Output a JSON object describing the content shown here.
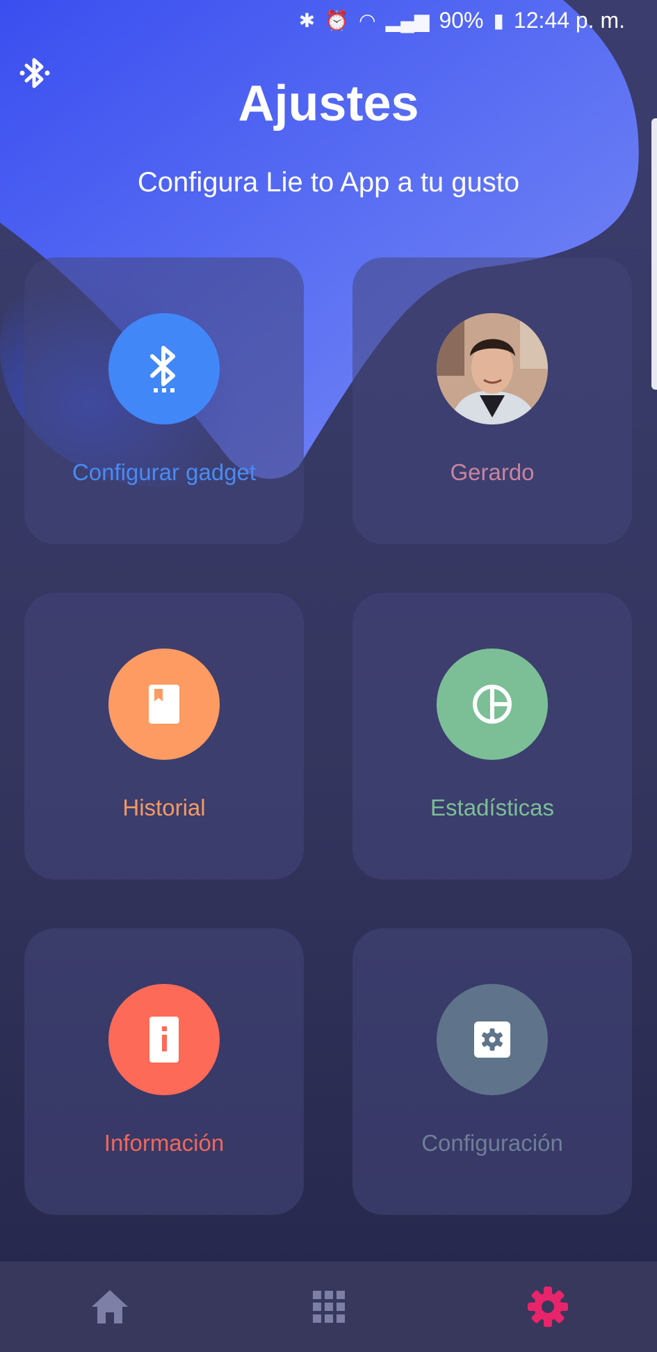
{
  "status_bar": {
    "battery": "90%",
    "time": "12:44 p. m.",
    "icons": [
      "bluetooth-icon",
      "alarm-icon",
      "wifi-icon",
      "signal-icon",
      "battery-icon"
    ]
  },
  "header": {
    "title": "Ajustes",
    "subtitle": "Configura Lie to App a tu gusto"
  },
  "cards": [
    {
      "label": "Configurar gadget",
      "icon": "bluetooth-searching-icon",
      "circle_color": "#4187f8",
      "label_color": "#4a8bf2"
    },
    {
      "label": "Gerardo",
      "icon": "avatar",
      "circle_color": "#b89882",
      "label_color": "#c9849f"
    },
    {
      "label": "Historial",
      "icon": "book-icon",
      "circle_color": "#fd9b62",
      "label_color": "#f59a62"
    },
    {
      "label": "Estadísticas",
      "icon": "pie-chart-icon",
      "circle_color": "#7cbf97",
      "label_color": "#7cbf97"
    },
    {
      "label": "Información",
      "icon": "info-icon",
      "circle_color": "#fe6a58",
      "label_color": "#f0685a"
    },
    {
      "label": "Configuración",
      "icon": "settings-icon",
      "circle_color": "#5f748a",
      "label_color": "#6f7f98"
    }
  ],
  "nav": {
    "items": [
      "home-icon",
      "apps-grid-icon",
      "settings-icon"
    ],
    "active_color": "#e8246a",
    "inactive_color": "#7d7fa6"
  }
}
